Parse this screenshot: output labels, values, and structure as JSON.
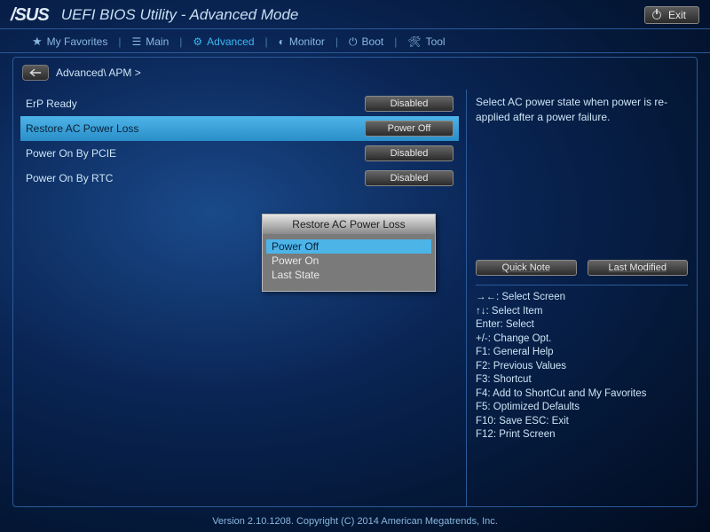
{
  "header": {
    "brand": "/SUS",
    "title": "UEFI BIOS Utility - Advanced Mode",
    "exit_label": "Exit"
  },
  "tabs": {
    "favorites": "My Favorites",
    "main": "Main",
    "advanced": "Advanced",
    "monitor": "Monitor",
    "boot": "Boot",
    "tool": "Tool"
  },
  "breadcrumb": "Advanced\\ APM >",
  "settings": [
    {
      "label": "ErP Ready",
      "value": "Disabled",
      "selected": false
    },
    {
      "label": "Restore AC Power Loss",
      "value": "Power Off",
      "selected": true
    },
    {
      "label": "Power On By PCIE",
      "value": "Disabled",
      "selected": false
    },
    {
      "label": "Power On By RTC",
      "value": "Disabled",
      "selected": false
    }
  ],
  "popup": {
    "title": "Restore AC Power Loss",
    "options": [
      "Power Off",
      "Power On",
      "Last State"
    ],
    "selected_index": 0
  },
  "help": "Select AC power state when power is re-applied after a power failure.",
  "right_buttons": {
    "quick_note": "Quick Note",
    "last_modified": "Last Modified"
  },
  "hints": [
    "→←: Select Screen",
    "↑↓: Select Item",
    "Enter: Select",
    "+/-: Change Opt.",
    "F1: General Help",
    "F2: Previous Values",
    "F3: Shortcut",
    "F4: Add to ShortCut and My Favorites",
    "F5: Optimized Defaults",
    "F10: Save   ESC: Exit",
    "F12: Print Screen"
  ],
  "footer": "Version 2.10.1208. Copyright (C) 2014 American Megatrends, Inc."
}
